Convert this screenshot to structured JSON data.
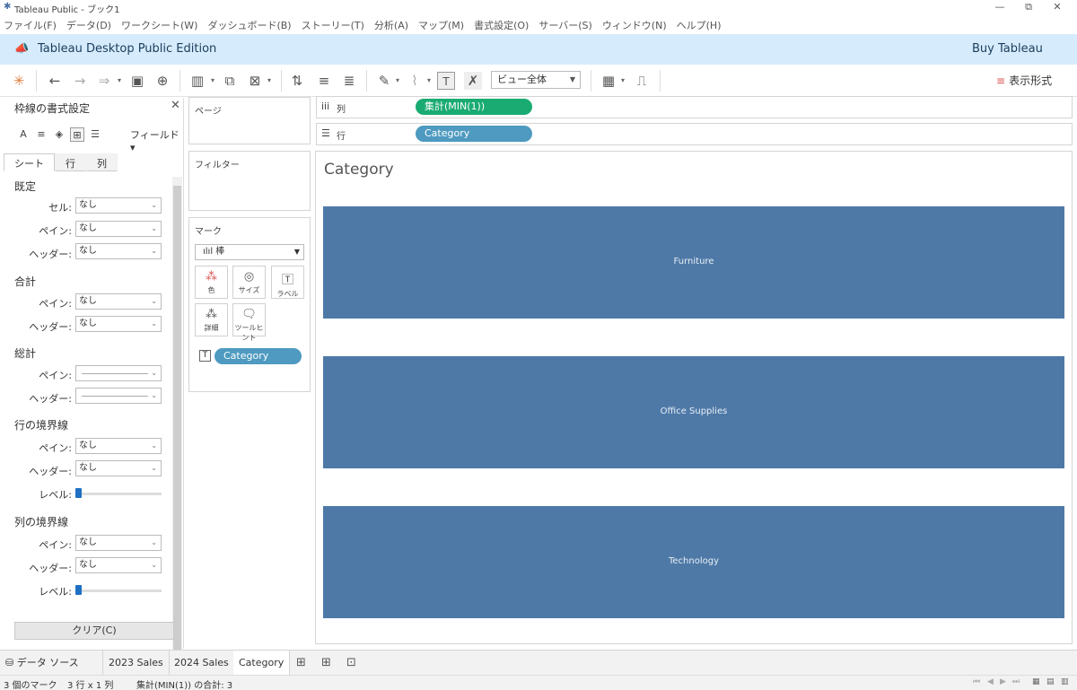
{
  "window": {
    "title": "Tableau Public - ブック1",
    "minimize": "—",
    "restore": "⧉",
    "close": "✕"
  },
  "menu": [
    "ファイル(F)",
    "データ(D)",
    "ワークシート(W)",
    "ダッシュボード(B)",
    "ストーリー(T)",
    "分析(A)",
    "マップ(M)",
    "書式設定(O)",
    "サーバー(S)",
    "ウィンドウ(N)",
    "ヘルプ(H)"
  ],
  "banner": {
    "edition": "Tableau Desktop Public Edition",
    "buy": "Buy Tableau"
  },
  "toolbar": {
    "fit": "ビュー全体",
    "show_me": "表示形式"
  },
  "format_pane": {
    "title": "枠線の書式設定",
    "field_dropdown": "フィールド▾",
    "tabs": [
      "シート",
      "行",
      "列"
    ],
    "sections": {
      "default": "既定",
      "total": "合計",
      "grand_total": "総計",
      "row_divider": "行の境界線",
      "col_divider": "列の境界線"
    },
    "labels": {
      "cell": "セル:",
      "pane": "ペイン:",
      "header": "ヘッダー:",
      "level": "レベル:"
    },
    "value_none": "なし",
    "clear": "クリア(C)"
  },
  "cards": {
    "pages": "ページ",
    "filters": "フィルター",
    "marks": "マーク",
    "mark_type": "棒",
    "buttons": {
      "color": "色",
      "size": "サイズ",
      "label": "ラベル",
      "detail": "詳細",
      "tooltip": "ツールヒント"
    },
    "label_pill": "Category"
  },
  "shelves": {
    "columns_name": "列",
    "columns_pill": "集計(MIN(1))",
    "rows_name": "行",
    "rows_pill": "Category"
  },
  "view": {
    "title": "Category"
  },
  "chart_data": {
    "type": "bar",
    "orientation": "horizontal",
    "categories": [
      "Furniture",
      "Office Supplies",
      "Technology"
    ],
    "values": [
      1,
      1,
      1
    ],
    "measure": "集計(MIN(1))",
    "bar_color": "#4e79a7",
    "xlim": [
      0,
      1
    ]
  },
  "tabs": {
    "data_source": "データ ソース",
    "sheets": [
      "2023 Sales",
      "2024 Sales",
      "Category"
    ],
    "active": "Category"
  },
  "status": {
    "marks": "3 個のマーク",
    "dims": "3 行 x 1 列",
    "sum": "集計(MIN(1)) の合計: 3"
  },
  "colors": {
    "banner_bg": "#d6ebfb",
    "green_pill": "#1aab72",
    "blue_pill": "#4e9ac0",
    "bar": "#4e79a7"
  }
}
